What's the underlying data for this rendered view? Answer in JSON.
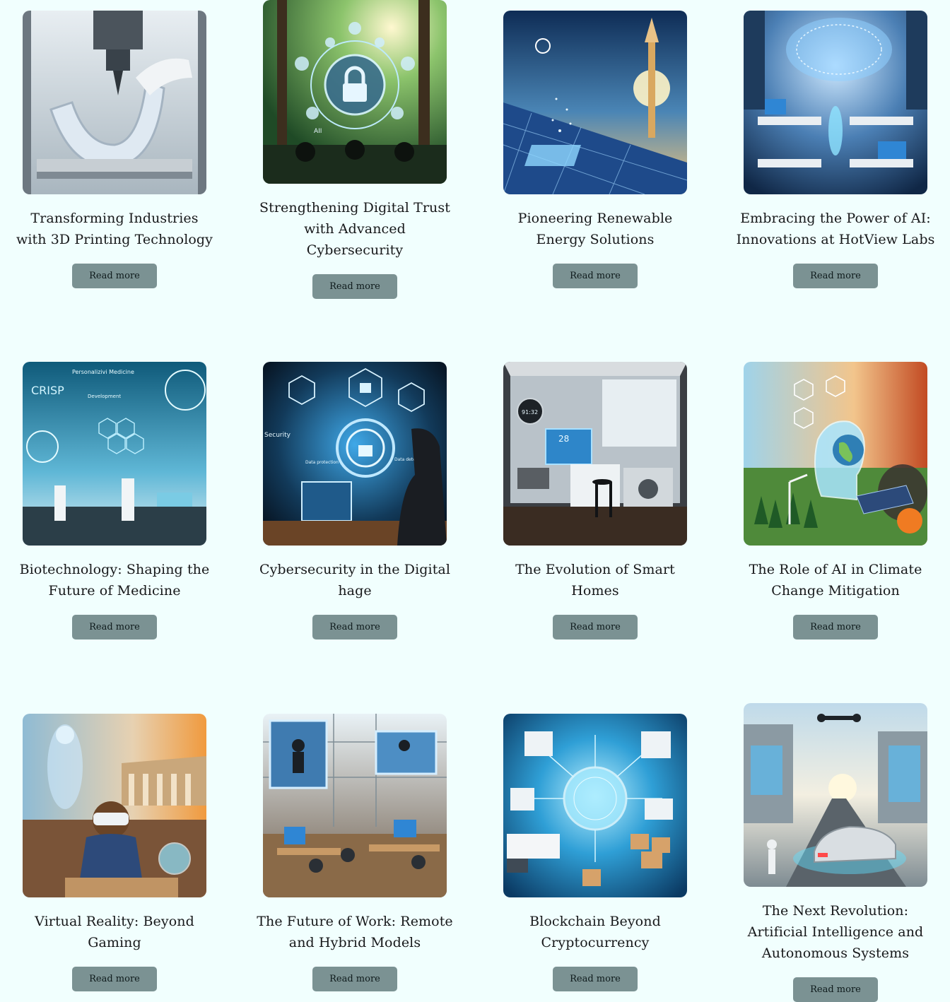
{
  "articles": [
    {
      "title": "Transforming Industries with 3D Printing Technology",
      "button_label": "Read more",
      "image_icon": "3d-printer-jaw-illustration"
    },
    {
      "title": "Strengthening Digital Trust with Advanced Cybersecurity",
      "button_label": "Read more",
      "image_icon": "forest-padlock-network-illustration"
    },
    {
      "title": "Pioneering Renewable Energy Solutions",
      "button_label": "Read more",
      "image_icon": "solar-panels-tower-illustration"
    },
    {
      "title": "Embracing the Power of AI: Innovations at HotView Labs",
      "button_label": "Read more",
      "image_icon": "ai-brain-lab-illustration"
    },
    {
      "title": "Biotechnology: Shaping the Future of Medicine",
      "button_label": "Read more",
      "image_icon": "biotech-lab-illustration"
    },
    {
      "title": "Cybersecurity in the Digital hage",
      "button_label": "Read more",
      "image_icon": "cyber-padlock-desk-illustration"
    },
    {
      "title": "The Evolution of Smart Homes",
      "button_label": "Read more",
      "image_icon": "smart-kitchen-illustration"
    },
    {
      "title": "The Role of AI in Climate Change Mitigation",
      "button_label": "Read more",
      "image_icon": "ai-climate-head-illustration"
    },
    {
      "title": "Virtual Reality: Beyond Gaming",
      "button_label": "Read more",
      "image_icon": "vr-classroom-illustration"
    },
    {
      "title": "The Future of Work: Remote and Hybrid Models",
      "button_label": "Read more",
      "image_icon": "hybrid-office-illustration"
    },
    {
      "title": "Blockchain Beyond Cryptocurrency",
      "button_label": "Read more",
      "image_icon": "blockchain-logistics-illustration"
    },
    {
      "title": "The Next Revolution: Artificial Intelligence and Autonomous Systems",
      "button_label": "Read more",
      "image_icon": "autonomous-car-city-illustration"
    }
  ],
  "image_texts": {
    "crisp": "CRISP",
    "personalized": "Personalizivi Medicine",
    "development": "Development",
    "data_protection": "Data protection",
    "data_detection": "Data detection",
    "security": "Security",
    "clock": "91:32",
    "temp": "28",
    "ai": "AII"
  },
  "colors": {
    "page_background": "#f1fffe",
    "button_background": "#7b9293",
    "title_text": "#17181a"
  }
}
